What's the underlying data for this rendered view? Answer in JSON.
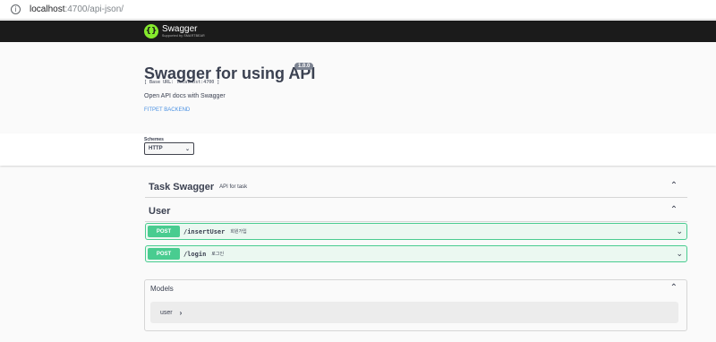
{
  "browser": {
    "info_icon": "info-icon",
    "url_host": "localhost",
    "url_rest": ":4700/api-json/"
  },
  "topbar": {
    "logo_glyph": "{}",
    "logo_name": "Swagger",
    "logo_sub": "Supported by SMARTBEAR"
  },
  "info": {
    "title": "Swagger for using API",
    "version": "1.0.0",
    "base_url": "[ Base URL: localhost:4700 ]",
    "description": "Open API docs with Swagger",
    "link": "FITPET BACKEND"
  },
  "schemes": {
    "title": "Schemes",
    "selected": "HTTP"
  },
  "tags": [
    {
      "name": "Task Swagger",
      "description": "API for task"
    },
    {
      "name": "User",
      "description": ""
    }
  ],
  "operations": [
    {
      "method": "POST",
      "path": "/insertUser",
      "summary": "회원가입"
    },
    {
      "method": "POST",
      "path": "/login",
      "summary": "로그인"
    }
  ],
  "models": {
    "title": "Models",
    "items": [
      "user"
    ]
  },
  "colors": {
    "topbar": "#1b1b1b",
    "logo_green": "#85ea2d",
    "post_green": "#49cc90",
    "post_bg": "#ebf8f1",
    "link": "#4990e2"
  }
}
